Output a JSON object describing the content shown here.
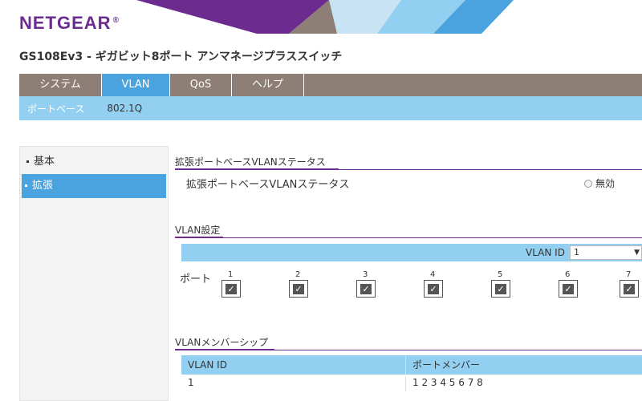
{
  "header": {
    "logo_text": "NETGEAR",
    "logo_mark": "®",
    "device_title": "GS108Ev3 - ギガビット8ポート アンマネージプラススイッチ"
  },
  "colors": {
    "brand_purple": "#6b2b8f",
    "nav_gray": "#8d7f76",
    "active_blue": "#4aa3df",
    "light_blue": "#93cff0"
  },
  "topnav": {
    "tabs": [
      {
        "label": "システム"
      },
      {
        "label": "VLAN"
      },
      {
        "label": "QoS"
      },
      {
        "label": "ヘルプ"
      }
    ],
    "active": "VLAN"
  },
  "subnav": {
    "items": [
      {
        "label": "ポートベース"
      },
      {
        "label": "802.1Q"
      }
    ],
    "active": "802.1Q"
  },
  "sidebar": {
    "items": [
      {
        "label": "基本"
      },
      {
        "label": "拡張"
      }
    ],
    "active": "拡張"
  },
  "status_section": {
    "title": "拡張ポートベースVLANステータス",
    "row_label": "拡張ポートベースVLANステータス",
    "radio_label": "無効"
  },
  "vlan_settings": {
    "title": "VLAN設定",
    "vlan_id_label": "VLAN ID",
    "vlan_id_value": "1",
    "port_label": "ポート",
    "ports": [
      "1",
      "2",
      "3",
      "4",
      "5",
      "6",
      "7"
    ],
    "port_checked": "✓"
  },
  "membership": {
    "title": "VLANメンバーシップ",
    "columns": [
      "VLAN ID",
      "ポートメンバー"
    ],
    "rows": [
      [
        "1",
        "1 2 3 4 5 6 7 8"
      ]
    ]
  }
}
